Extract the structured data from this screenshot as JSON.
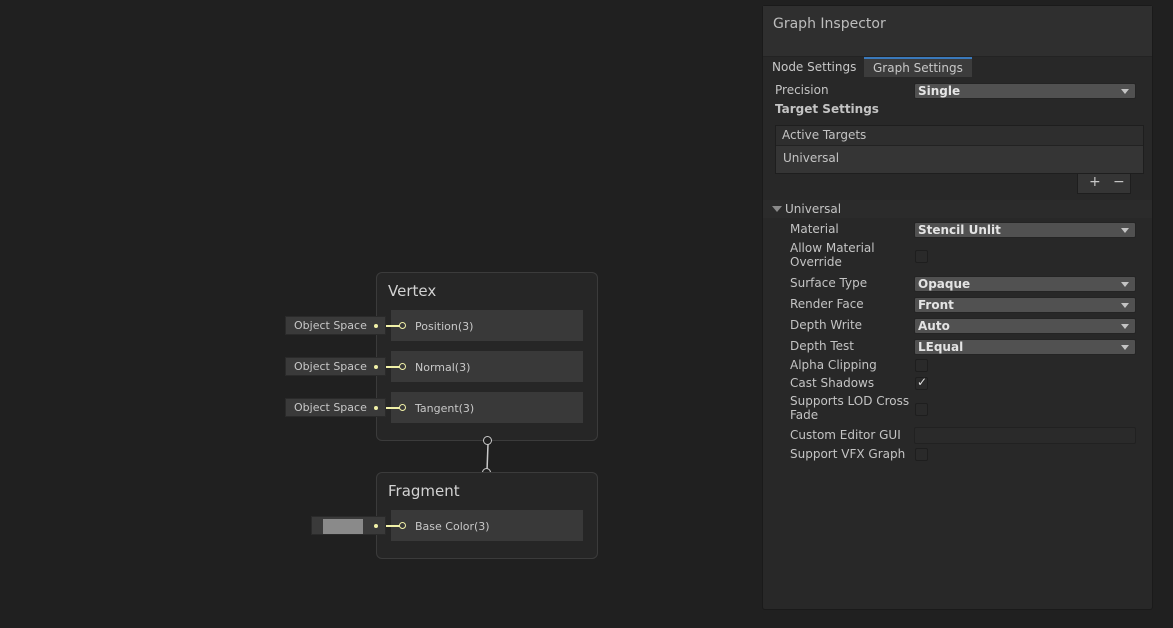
{
  "graph": {
    "vertex_node": {
      "title": "Vertex",
      "ports": [
        {
          "label": "Position(3)",
          "inline": "Object Space"
        },
        {
          "label": "Normal(3)",
          "inline": "Object Space"
        },
        {
          "label": "Tangent(3)",
          "inline": "Object Space"
        }
      ]
    },
    "fragment_node": {
      "title": "Fragment",
      "ports": [
        {
          "label": "Base Color(3)",
          "swatch_color": "#8a8a8a"
        }
      ]
    },
    "port_color": "#f1f1a8"
  },
  "inspector": {
    "title": "Graph Inspector",
    "tabs": [
      {
        "label": "Node Settings",
        "active": false
      },
      {
        "label": "Graph Settings",
        "active": true
      }
    ],
    "precision": {
      "label": "Precision",
      "value": "Single"
    },
    "target_settings_label": "Target Settings",
    "active_targets": {
      "header": "Active Targets",
      "items": [
        "Universal"
      ],
      "add_label": "+",
      "remove_label": "−"
    },
    "universal": {
      "foldout_label": "Universal",
      "material": {
        "label": "Material",
        "value": "Stencil Unlit"
      },
      "allow_material_override": {
        "label": "Allow Material Override",
        "checked": false
      },
      "surface_type": {
        "label": "Surface Type",
        "value": "Opaque"
      },
      "render_face": {
        "label": "Render Face",
        "value": "Front"
      },
      "depth_write": {
        "label": "Depth Write",
        "value": "Auto"
      },
      "depth_test": {
        "label": "Depth Test",
        "value": "LEqual"
      },
      "alpha_clipping": {
        "label": "Alpha Clipping",
        "checked": false
      },
      "cast_shadows": {
        "label": "Cast Shadows",
        "checked": true,
        "mark": "✓"
      },
      "supports_lod_cross_fade": {
        "label": "Supports LOD Cross Fade",
        "checked": false
      },
      "custom_editor_gui": {
        "label": "Custom Editor GUI",
        "value": ""
      },
      "support_vfx_graph": {
        "label": "Support VFX Graph",
        "checked": false
      }
    },
    "accent_color": "#3a79bb"
  }
}
